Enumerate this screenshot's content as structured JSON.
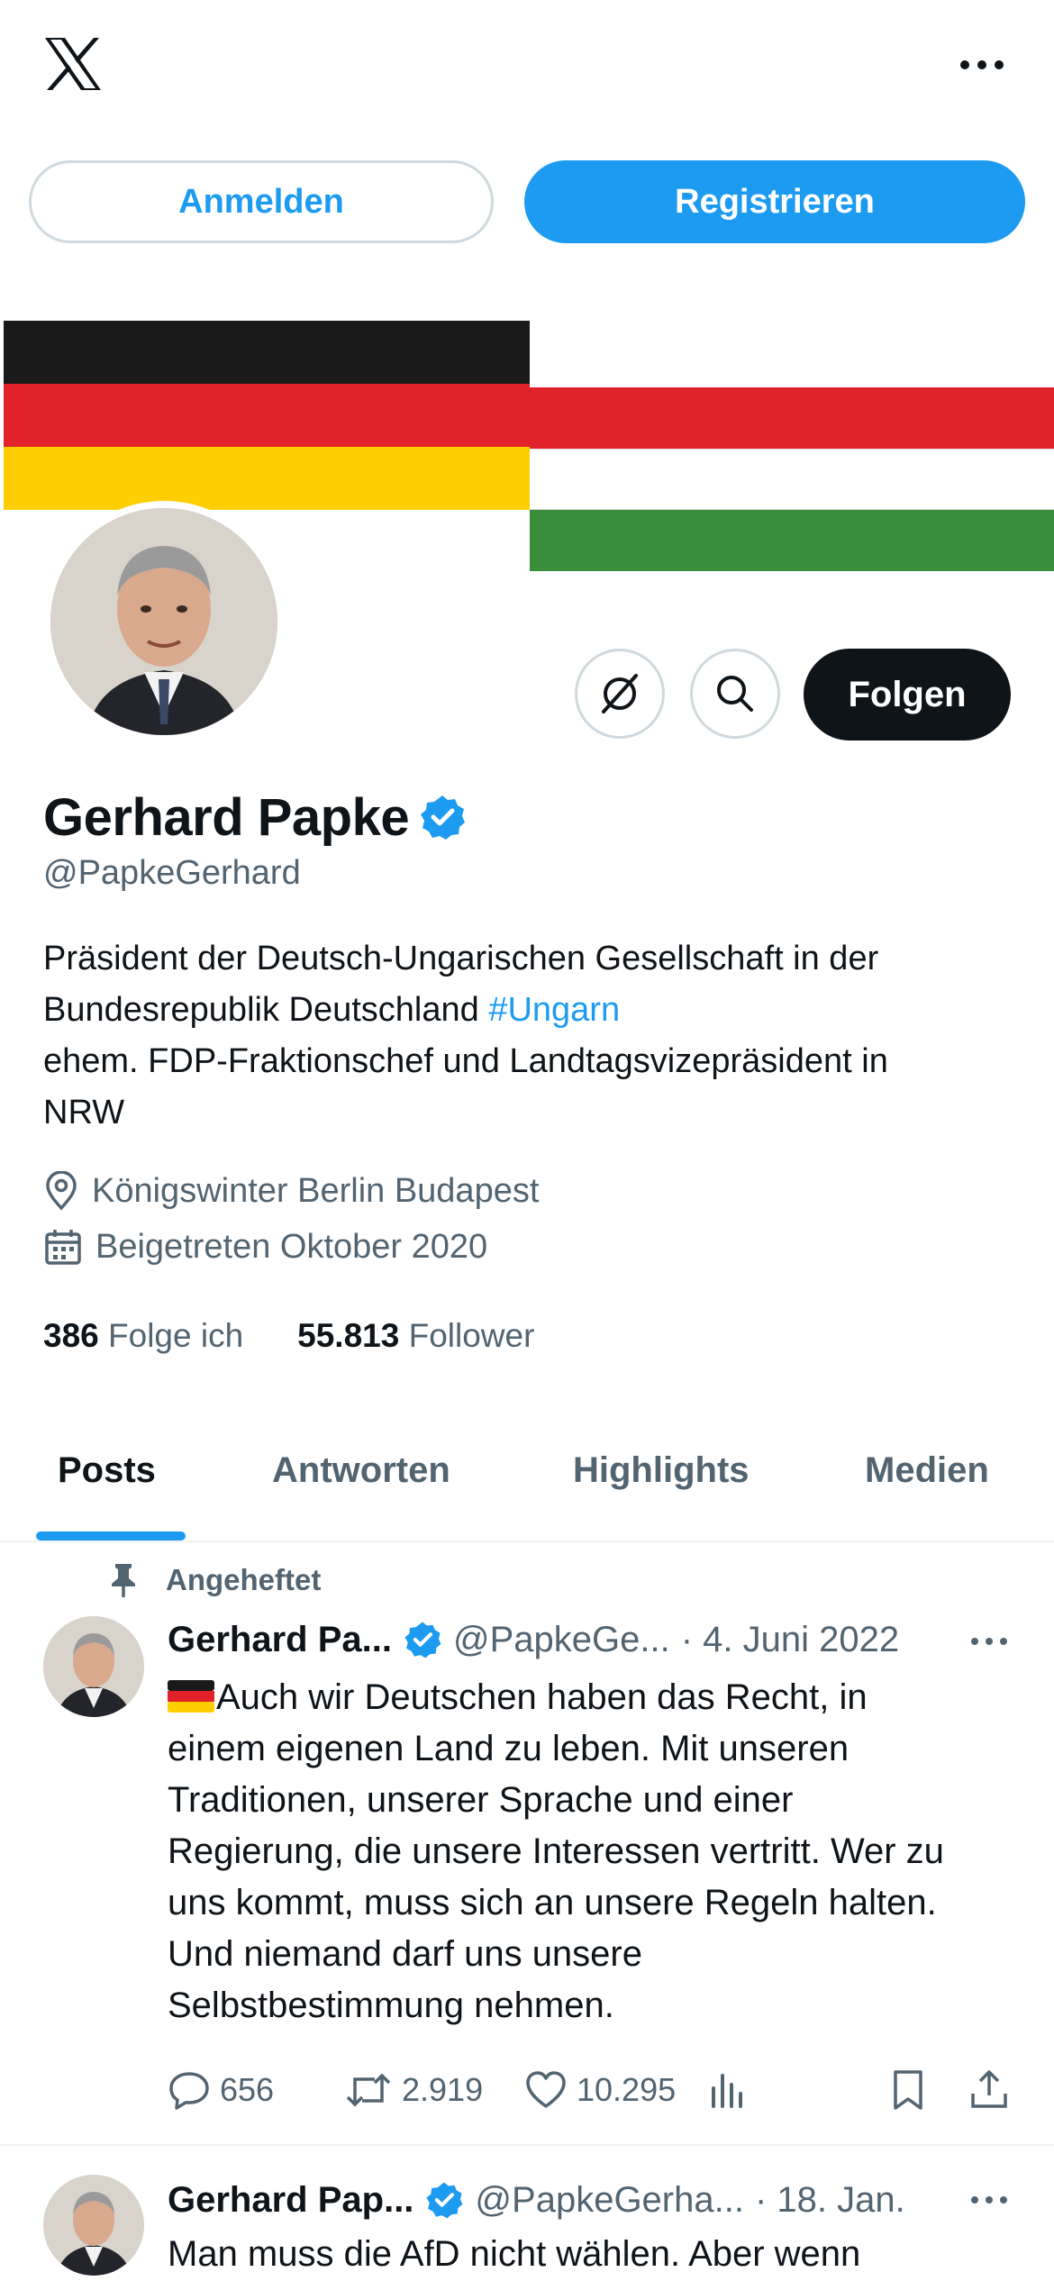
{
  "topbar": {
    "logo_icon": "x-logo-icon",
    "more_icon": "more-horizontal-icon"
  },
  "auth": {
    "login_label": "Anmelden",
    "register_label": "Registrieren"
  },
  "colors": {
    "accent": "#1d9bf0",
    "text_primary": "#0f1419",
    "text_secondary": "#536471",
    "flag_de": [
      "#1a1a1a",
      "#e2222a",
      "#ffce00"
    ],
    "flag_hu": [
      "#e2222a",
      "#ffffff",
      "#3a8d3a"
    ]
  },
  "profile": {
    "name": "Gerhard Papke",
    "handle": "@PapkeGerhard",
    "verified": true,
    "follow_label": "Folgen",
    "bio_line1": "Präsident der Deutsch-Ungarischen Gesellschaft in der",
    "bio_line2_text": "Bundesrepublik Deutschland ",
    "bio_hashtag": "#Ungarn",
    "bio_line3": "ehem. FDP-Fraktionschef und Landtagsvizepräsident in",
    "bio_line4": "NRW",
    "location": "Königswinter Berlin Budapest",
    "joined": "Beigetreten Oktober 2020",
    "following_count": "386",
    "following_label": "Folge ich",
    "followers_count": "55.813",
    "followers_label": "Follower"
  },
  "tabs": [
    {
      "label": "Posts",
      "active": true
    },
    {
      "label": "Antworten",
      "active": false
    },
    {
      "label": "Highlights",
      "active": false
    },
    {
      "label": "Medien",
      "active": false
    }
  ],
  "posts": [
    {
      "pinned_label": "Angeheftet",
      "name": "Gerhard Pa...",
      "handle": "@PapkeGe...",
      "date": "· 4. Juni 2022",
      "lines": [
        "Auch wir Deutschen haben das Recht, in",
        "einem eigenen Land zu leben. Mit unseren",
        "Traditionen, unserer Sprache und einer",
        "Regierung, die unsere Interessen vertritt. Wer zu",
        "uns kommt, muss sich an unsere Regeln halten.",
        "Und niemand darf uns unsere",
        "Selbstbestimmung nehmen."
      ],
      "replies": "656",
      "reposts": "2.919",
      "likes": "10.295"
    },
    {
      "name": "Gerhard Pap...",
      "handle": "@PapkeGerha...",
      "date": "· 18. Jan.",
      "lines": [
        "Man muss die AfD nicht wählen. Aber wenn"
      ]
    }
  ]
}
